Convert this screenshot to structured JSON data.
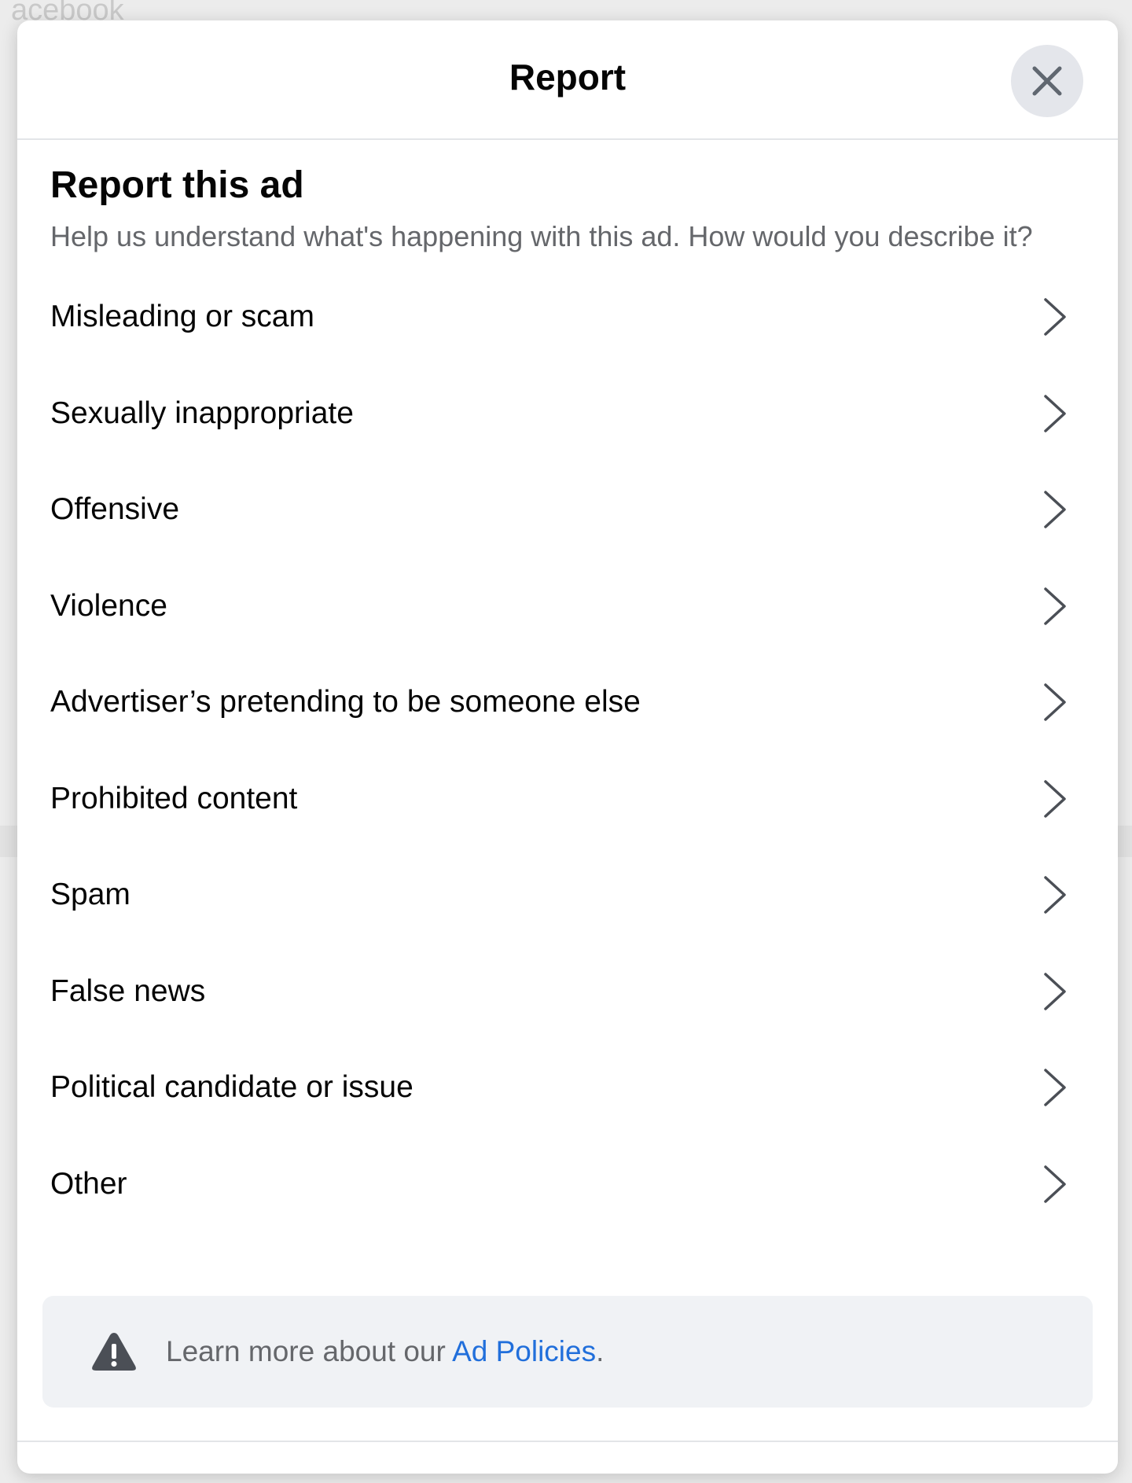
{
  "background": {
    "brand_text": "acebook"
  },
  "dialog": {
    "title": "Report",
    "close_icon": "close-icon"
  },
  "section": {
    "heading": "Report this ad",
    "description": "Help us understand what's happening with this ad. How would you describe it?"
  },
  "options": [
    {
      "label": "Misleading or scam",
      "icon": "chevron-right-icon"
    },
    {
      "label": "Sexually inappropriate",
      "icon": "chevron-right-icon"
    },
    {
      "label": "Offensive",
      "icon": "chevron-right-icon"
    },
    {
      "label": "Violence",
      "icon": "chevron-right-icon"
    },
    {
      "label": "Advertiser’s pretending to be someone else",
      "icon": "chevron-right-icon"
    },
    {
      "label": "Prohibited content",
      "icon": "chevron-right-icon"
    },
    {
      "label": "Spam",
      "icon": "chevron-right-icon"
    },
    {
      "label": "False news",
      "icon": "chevron-right-icon"
    },
    {
      "label": "Political candidate or issue",
      "icon": "chevron-right-icon"
    },
    {
      "label": "Other",
      "icon": "chevron-right-icon"
    }
  ],
  "info": {
    "icon": "warning-icon",
    "prefix": "Learn more about our ",
    "link_text": "Ad Policies",
    "suffix": "."
  },
  "colors": {
    "primary_text": "#050505",
    "secondary_text": "#65676b",
    "link": "#216fdb",
    "info_box_bg": "#f0f2f5",
    "close_button_bg": "#e4e6eb",
    "divider": "#e3e5e8"
  }
}
